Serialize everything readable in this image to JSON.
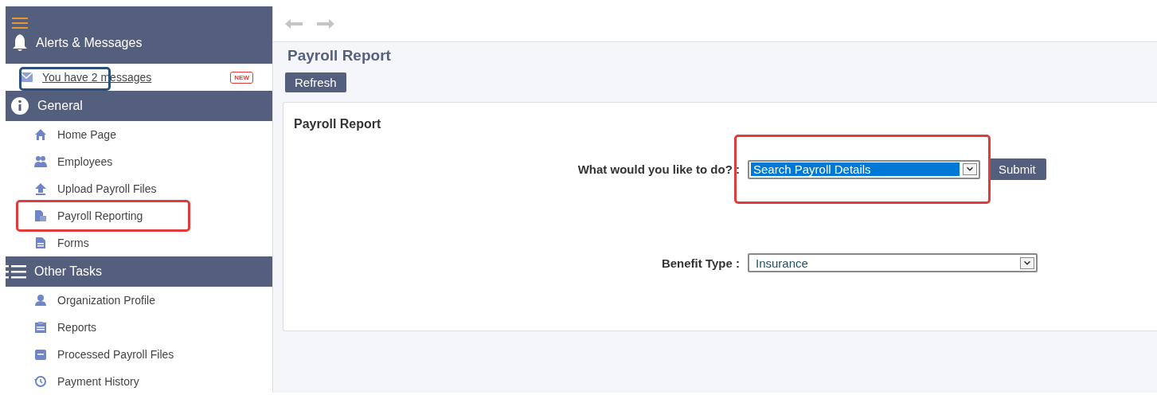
{
  "sidebar": {
    "alerts": {
      "title": "Alerts & Messages",
      "message": {
        "text": "You have 2 messages",
        "badge": "NEW",
        "highlight": {
          "color": "#2c4f7c"
        }
      }
    },
    "sections": [
      {
        "title": "General",
        "items": [
          {
            "label": "Home Page"
          },
          {
            "label": "Employees"
          },
          {
            "label": "Upload Payroll Files"
          },
          {
            "label": "Payroll Reporting",
            "highlight": {
              "color": "#e03c3c"
            }
          },
          {
            "label": "Forms"
          }
        ]
      },
      {
        "title": "Other Tasks",
        "items": [
          {
            "label": "Organization Profile"
          },
          {
            "label": "Reports"
          },
          {
            "label": "Processed Payroll Files"
          },
          {
            "label": "Payment History"
          }
        ]
      }
    ]
  },
  "page": {
    "title": "Payroll Report",
    "refresh": "Refresh",
    "card": {
      "title": "Payroll Report",
      "fields": [
        {
          "label": "What would you like to do? :",
          "value": "Search Payroll Details",
          "selected": true,
          "button": "Submit",
          "highlight": {
            "color": "#e03c3c"
          }
        },
        {
          "label": "Benefit Type :",
          "value": "Insurance",
          "selected": false
        }
      ]
    }
  }
}
